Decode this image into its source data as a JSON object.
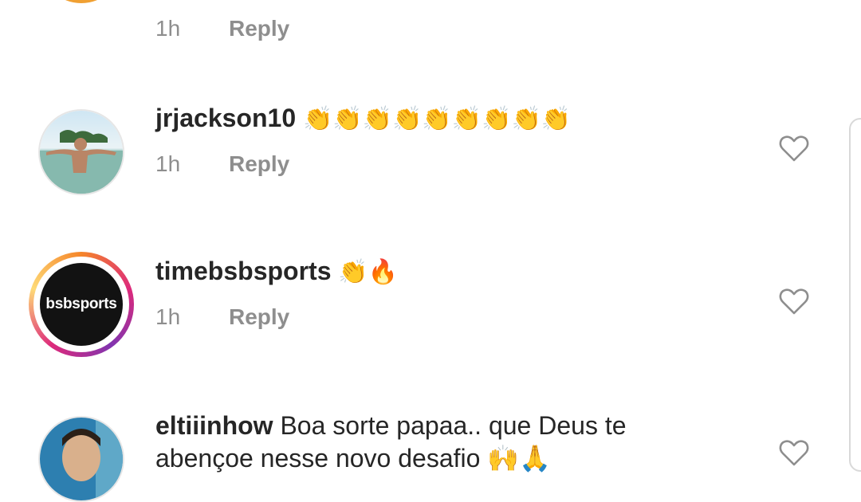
{
  "top_partial": {
    "time": "1h",
    "reply": "Reply"
  },
  "comments": [
    {
      "username": "jrjackson10",
      "text": "",
      "emojis": "👏👏👏👏👏👏👏👏👏",
      "time": "1h",
      "reply": "Reply"
    },
    {
      "username": "timebsbsports",
      "text": "",
      "emojis": "👏🔥",
      "time": "1h",
      "reply": "Reply",
      "avatar_logo": "bsbsports"
    },
    {
      "username": "eltiiinhow",
      "text": "Boa sorte papaa.. que Deus te",
      "text2": "abençoe nesse novo desafio 🙌🙏",
      "time": "",
      "reply": ""
    }
  ],
  "icons": {
    "like": "heart-outline-icon"
  },
  "colors": {
    "primary_text": "#262626",
    "secondary_text": "#8e8e8e",
    "story_ring": "#dd2a7b",
    "top_ring": "#f0a032"
  }
}
